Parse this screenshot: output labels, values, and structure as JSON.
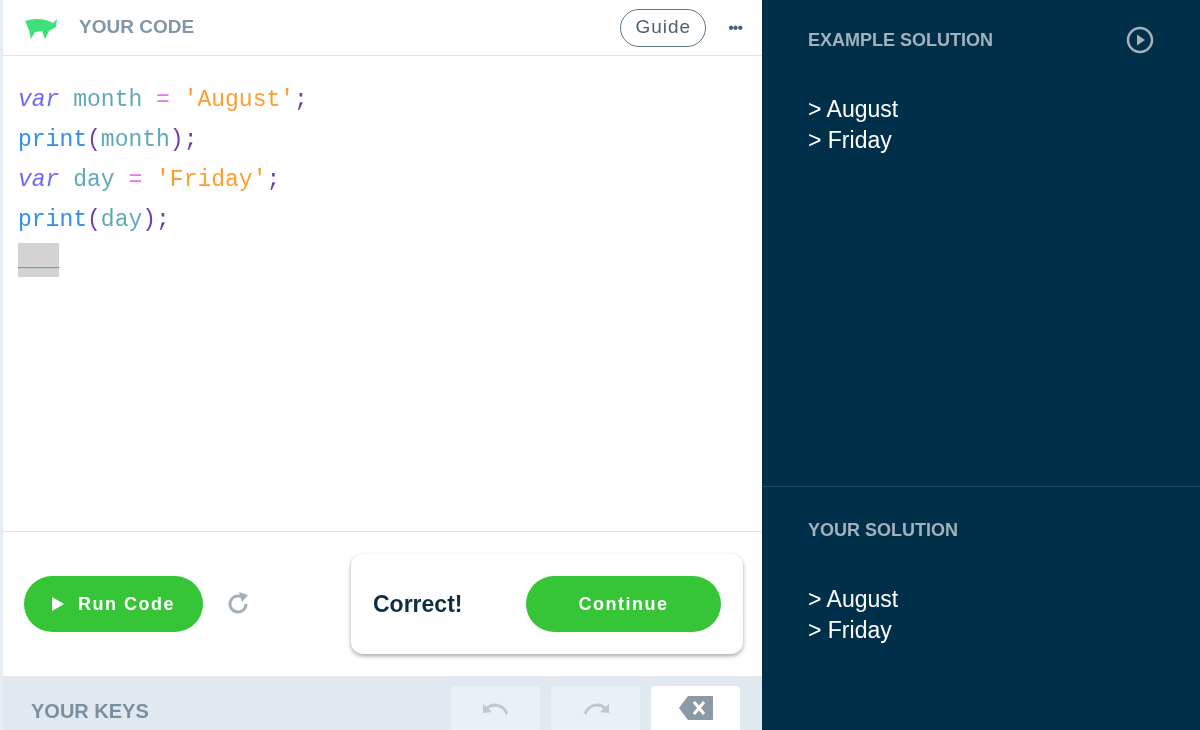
{
  "editor": {
    "title": "YOUR CODE",
    "guide_button": "Guide",
    "more_button": "•••",
    "lines": [
      [
        {
          "kind": "keyword",
          "text": "var"
        },
        {
          "kind": "variable",
          "text": " month"
        },
        {
          "kind": "operator",
          "text": " ="
        },
        {
          "kind": "string",
          "text": " 'August'"
        },
        {
          "kind": "punct",
          "text": ";"
        }
      ],
      [
        {
          "kind": "function",
          "text": "print"
        },
        {
          "kind": "paren",
          "text": "("
        },
        {
          "kind": "variable",
          "text": "month"
        },
        {
          "kind": "paren",
          "text": ")"
        },
        {
          "kind": "punct",
          "text": ";"
        }
      ],
      [
        {
          "kind": "keyword",
          "text": "var"
        },
        {
          "kind": "variable",
          "text": " day"
        },
        {
          "kind": "operator",
          "text": " ="
        },
        {
          "kind": "string",
          "text": " 'Friday'"
        },
        {
          "kind": "punct",
          "text": ";"
        }
      ],
      [
        {
          "kind": "function",
          "text": "print"
        },
        {
          "kind": "paren",
          "text": "("
        },
        {
          "kind": "variable",
          "text": "day"
        },
        {
          "kind": "paren",
          "text": ")"
        },
        {
          "kind": "punct",
          "text": ";"
        }
      ],
      [
        {
          "kind": "blank",
          "text": "___"
        }
      ]
    ]
  },
  "run_button": "Run Code",
  "feedback": {
    "message": "Correct!",
    "button": "Continue"
  },
  "keys": {
    "title": "YOUR KEYS",
    "buttons": [
      {
        "kind": "undo",
        "disabled": true
      },
      {
        "kind": "redo",
        "disabled": true
      },
      {
        "kind": "backspace",
        "disabled": false
      }
    ]
  },
  "example_solution": {
    "title": "EXAMPLE SOLUTION",
    "output": [
      "> August",
      "> Friday"
    ]
  },
  "your_solution": {
    "title": "YOUR SOLUTION",
    "output": [
      "> August",
      "> Friday"
    ]
  }
}
